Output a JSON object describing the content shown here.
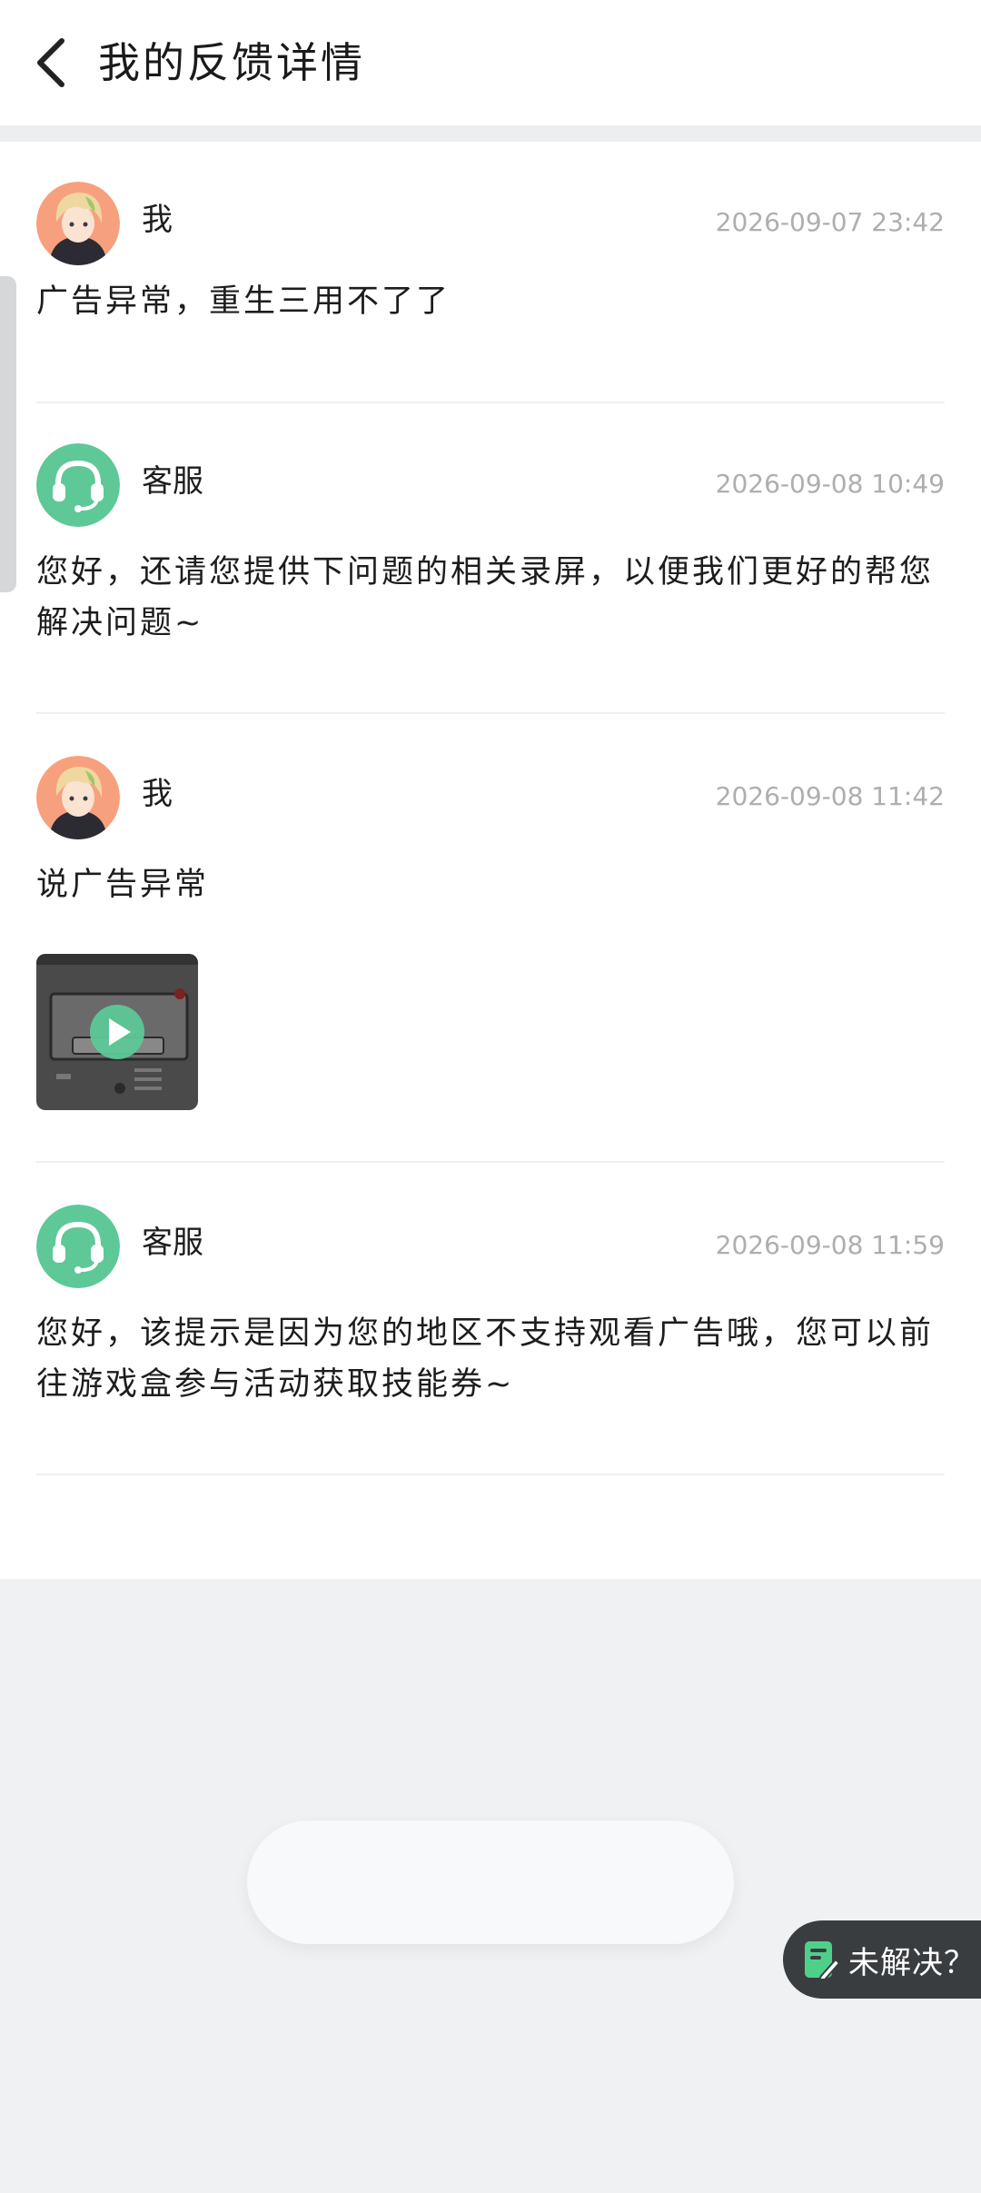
{
  "header": {
    "title": "我的反馈详情",
    "back_icon": "chevron-left-icon"
  },
  "colors": {
    "accent": "#5ec897",
    "timestamp": "#aeaeae",
    "page_background": "#f0f1f3",
    "unresolved_button": "#3a3d40"
  },
  "messages": [
    {
      "sender": "我",
      "avatar": "user-avatar",
      "time": "2026-09-07 23:42",
      "text": "广告异常，重生三用不了了"
    },
    {
      "sender": "客服",
      "avatar": "headset-icon",
      "time": "2026-09-08 10:49",
      "text": "您好，还请您提供下问题的相关录屏，以便我们更好的帮您解决问题~"
    },
    {
      "sender": "我",
      "avatar": "user-avatar",
      "time": "2026-09-08 11:42",
      "text": "说广告异常",
      "attachment": "video-thumbnail"
    },
    {
      "sender": "客服",
      "avatar": "headset-icon",
      "time": "2026-09-08 11:59",
      "text": "您好，该提示是因为您的地区不支持观看广告哦，您可以前往游戏盒参与活动获取技能券~"
    }
  ],
  "actions": {
    "unresolved_label": "未解决？",
    "unresolved_icon": "edit-note-icon"
  }
}
